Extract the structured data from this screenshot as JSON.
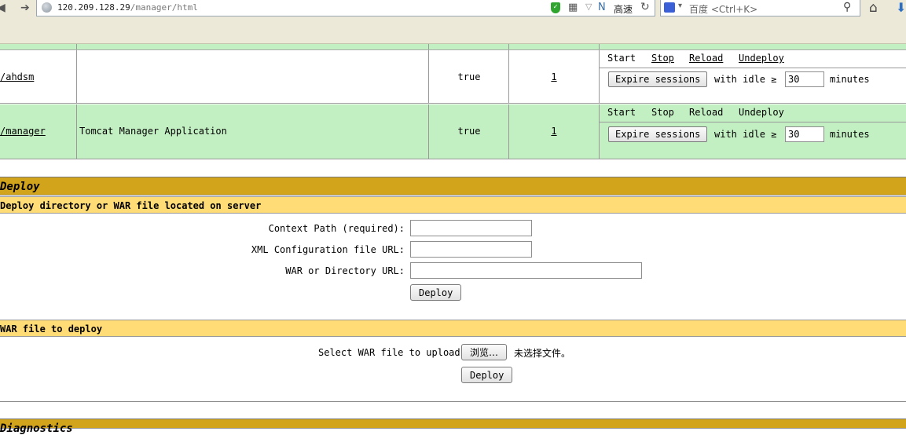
{
  "browser": {
    "url_host": "120.209.128.29",
    "url_path": "/manager/html",
    "speed_label": "高速",
    "search_placeholder": "百度 <Ctrl+K>",
    "icons": [
      "back-icon",
      "forward-icon",
      "globe-icon",
      "shield-icon",
      "qr-icon",
      "dropdown-icon",
      "speed-icon",
      "reload-icon",
      "baidu-icon",
      "search-icon",
      "home-icon",
      "download-icon"
    ]
  },
  "apps": {
    "rows": [
      {
        "path": "/ahdsm",
        "display_name": "",
        "running": "true",
        "sessions": "1",
        "commands": [
          "Start",
          "Stop",
          "Reload",
          "Undeploy"
        ],
        "expire_label": "Expire sessions",
        "with_idle": "with idle ≥",
        "idle_value": "30",
        "minutes": "minutes"
      },
      {
        "path": "/manager",
        "display_name": "Tomcat Manager Application",
        "running": "true",
        "sessions": "1",
        "commands": [
          "Start",
          "Stop",
          "Reload",
          "Undeploy"
        ],
        "expire_label": "Expire sessions",
        "with_idle": "with idle ≥",
        "idle_value": "30",
        "minutes": "minutes"
      }
    ]
  },
  "deploy": {
    "title": "Deploy",
    "server_section": "Deploy directory or WAR file located on server",
    "context_path_label": "Context Path (required):",
    "xml_config_label": "XML Configuration file URL:",
    "war_dir_label": "WAR or Directory URL:",
    "deploy_button": "Deploy",
    "war_section": "WAR file to deploy",
    "select_label": "Select WAR file to upload",
    "browse_button": "浏览…",
    "no_file": "未选择文件。",
    "upload_deploy_button": "Deploy"
  },
  "diagnostics": {
    "title": "Diagnostics"
  },
  "colors": {
    "row_green": "#c3f0c3",
    "section_dark": "#d2a41c",
    "section_light": "#ffdc75"
  }
}
